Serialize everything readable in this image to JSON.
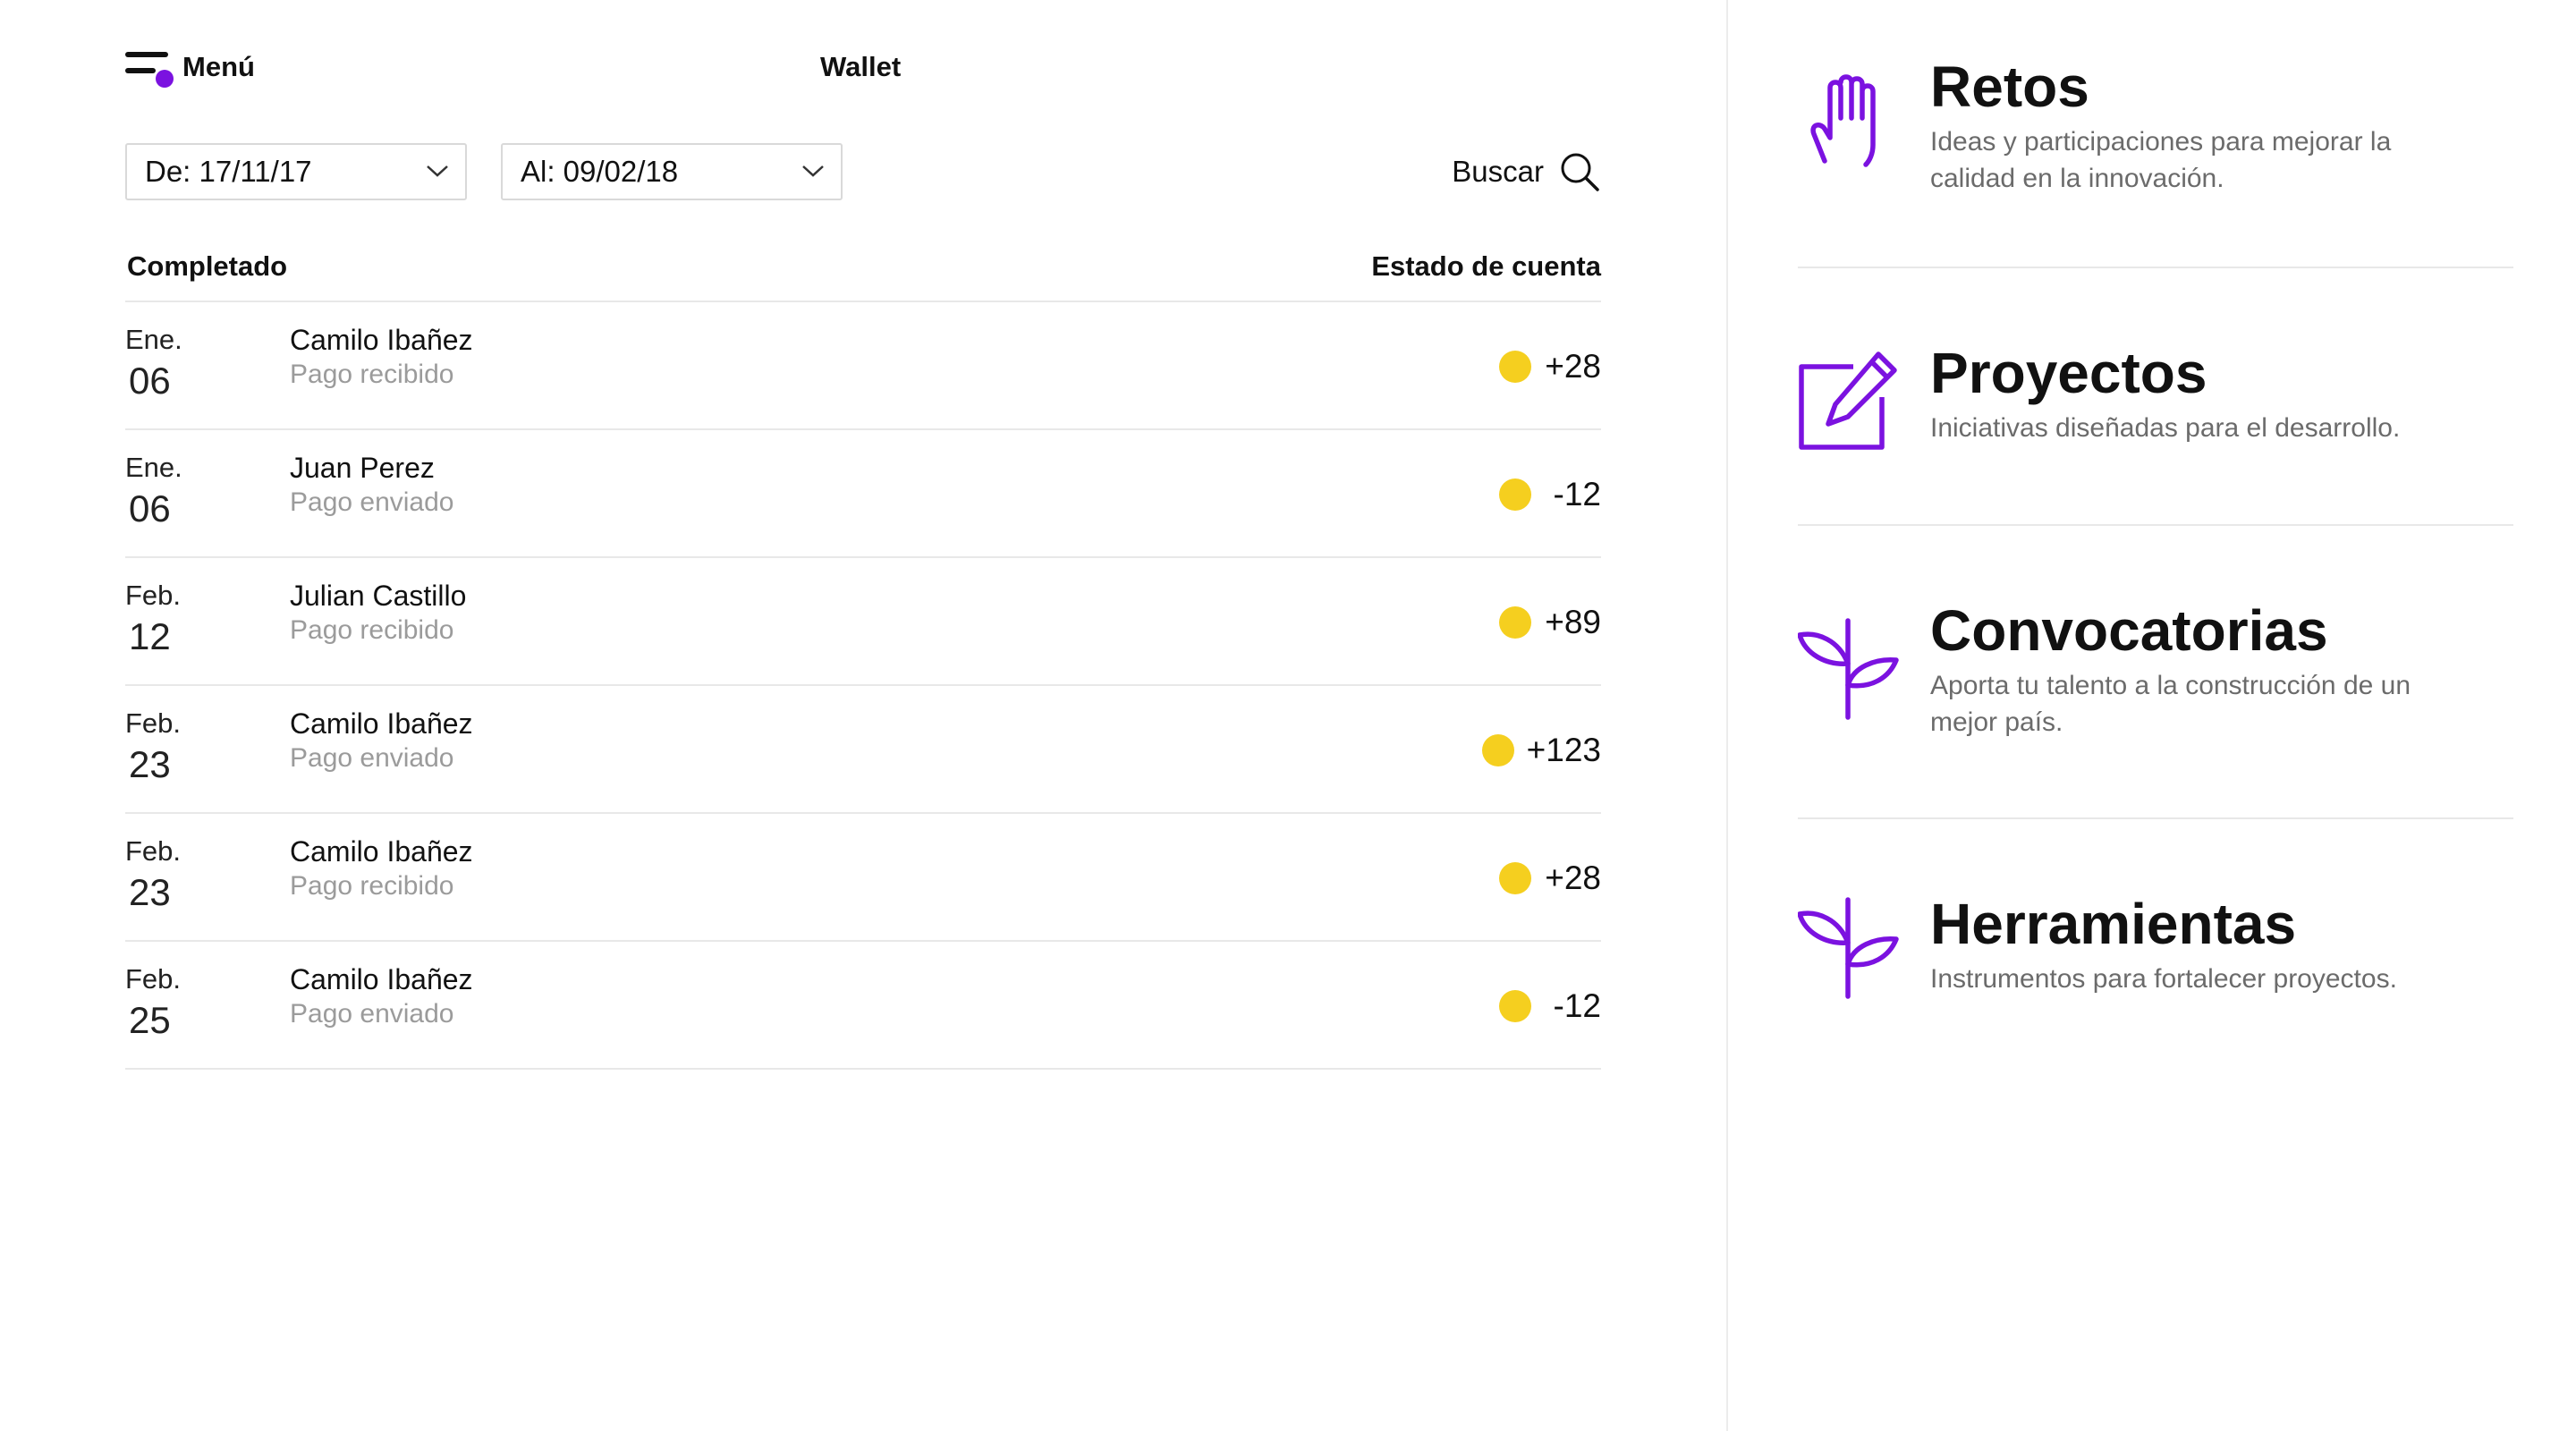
{
  "header": {
    "menu_label": "Menú",
    "title": "Wallet"
  },
  "filters": {
    "from": "De: 17/11/17",
    "to": "Al: 09/02/18",
    "search_label": "Buscar"
  },
  "table": {
    "left_header": "Completado",
    "right_header": "Estado de cuenta",
    "rows": [
      {
        "month": "Ene.",
        "day": "06",
        "name": "Camilo Ibañez",
        "desc": "Pago recibido",
        "amount": "+28"
      },
      {
        "month": "Ene.",
        "day": "06",
        "name": "Juan Perez",
        "desc": "Pago enviado",
        "amount": "-12"
      },
      {
        "month": "Feb.",
        "day": "12",
        "name": "Julian Castillo",
        "desc": "Pago recibido",
        "amount": "+89"
      },
      {
        "month": "Feb.",
        "day": "23",
        "name": "Camilo Ibañez",
        "desc": "Pago enviado",
        "amount": "+123"
      },
      {
        "month": "Feb.",
        "day": "23",
        "name": "Camilo Ibañez",
        "desc": "Pago recibido",
        "amount": "+28"
      },
      {
        "month": "Feb.",
        "day": "25",
        "name": "Camilo Ibañez",
        "desc": "Pago enviado",
        "amount": "-12"
      }
    ]
  },
  "categories": [
    {
      "icon": "hand-icon",
      "title": "Retos",
      "text": "Ideas  y participaciones para mejorar la calidad en la innovación."
    },
    {
      "icon": "edit-icon",
      "title": "Proyectos",
      "text": "Iniciativas diseñadas para el desarrollo."
    },
    {
      "icon": "sprout-icon",
      "title": "Convocatorias",
      "text": "Aporta tu talento a la construcción de un mejor país."
    },
    {
      "icon": "sprout-icon",
      "title": "Herramientas",
      "text": "Instrumentos para fortalecer proyectos."
    }
  ],
  "colors": {
    "accent": "#7b12e0",
    "coin": "#f5cf1f",
    "muted_text": "#9b9b9b",
    "divider": "#e8e8e8"
  }
}
